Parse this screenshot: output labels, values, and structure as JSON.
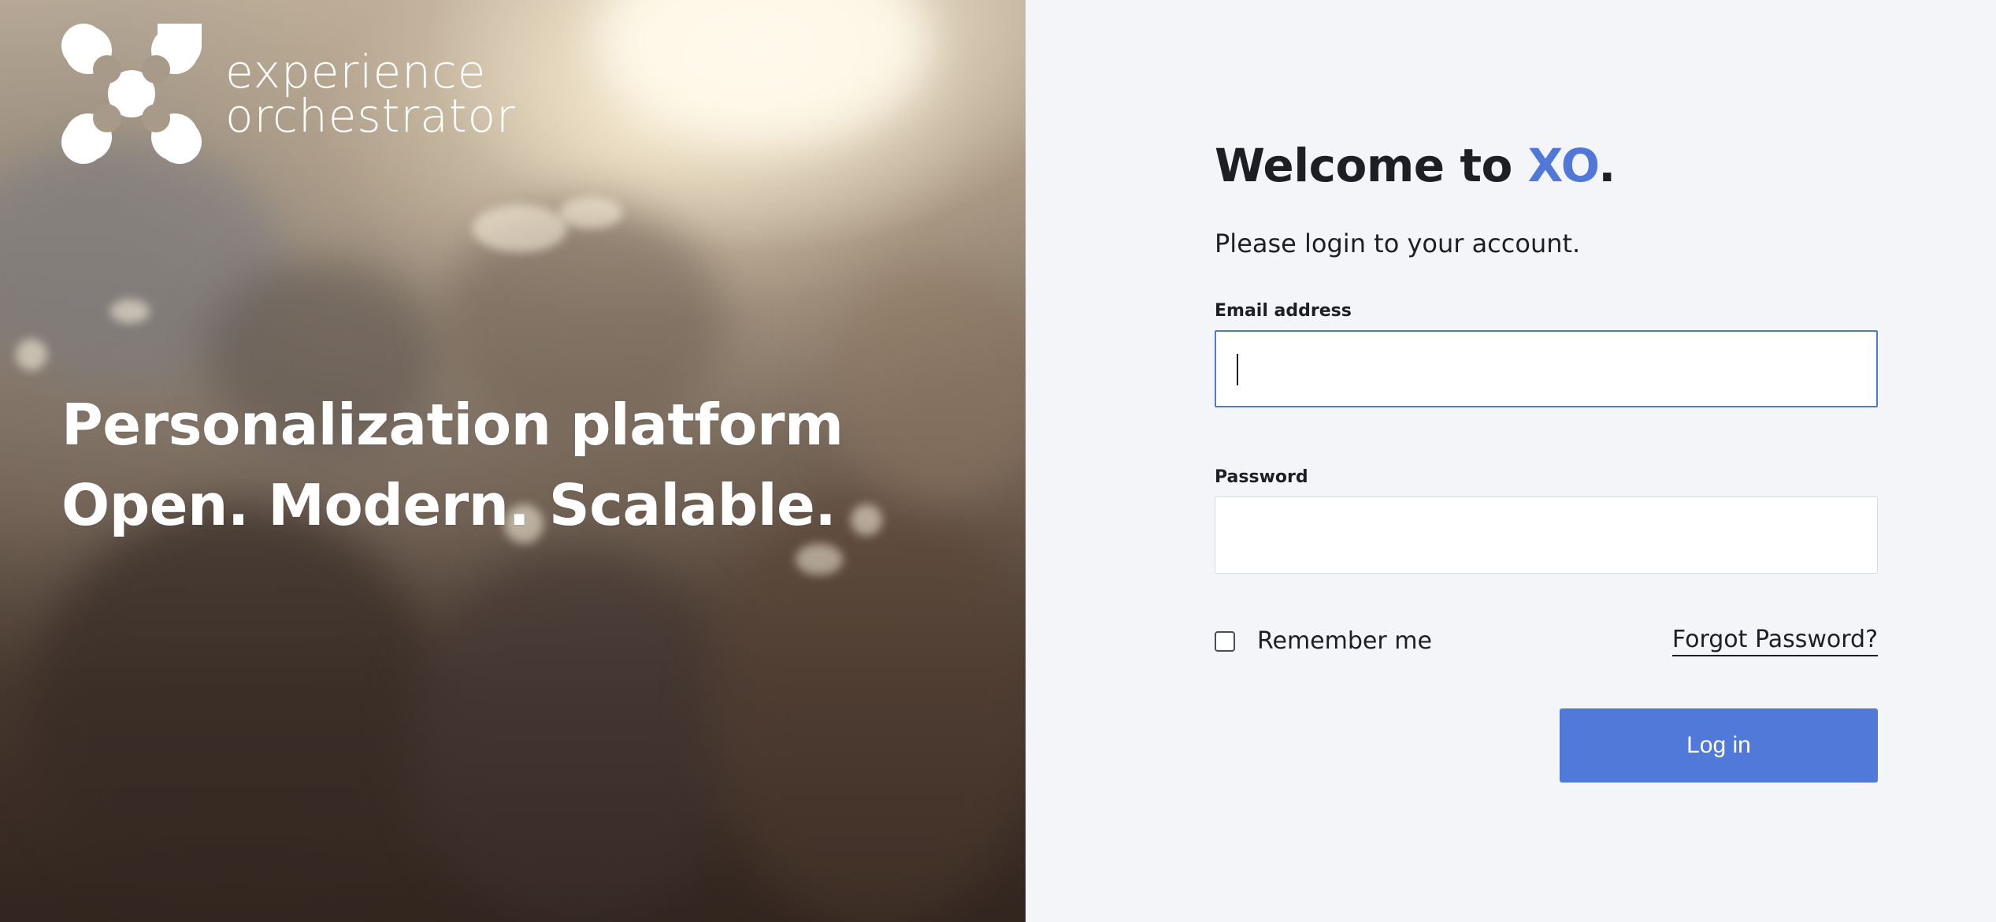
{
  "hero": {
    "logo": {
      "line1": "experience",
      "line2": "orchestrator",
      "icon": "xo-logo-icon"
    },
    "tagline": {
      "line1": "Personalization platform",
      "line2": "Open. Modern. Scalable."
    }
  },
  "login": {
    "title_prefix": "Welcome to ",
    "title_brand": "XO",
    "title_suffix": ".",
    "subtitle": "Please login to your account.",
    "email": {
      "label": "Email address",
      "value": "",
      "placeholder": ""
    },
    "password": {
      "label": "Password",
      "value": "",
      "placeholder": ""
    },
    "remember_me": {
      "label": "Remember me",
      "checked": false
    },
    "forgot_password": "Forgot Password?",
    "submit_label": "Log in"
  },
  "colors": {
    "brand_blue": "#4f78d8",
    "button_blue": "#5079d9",
    "panel_background": "#f3f5f9",
    "text_dark": "#1d1f24"
  }
}
